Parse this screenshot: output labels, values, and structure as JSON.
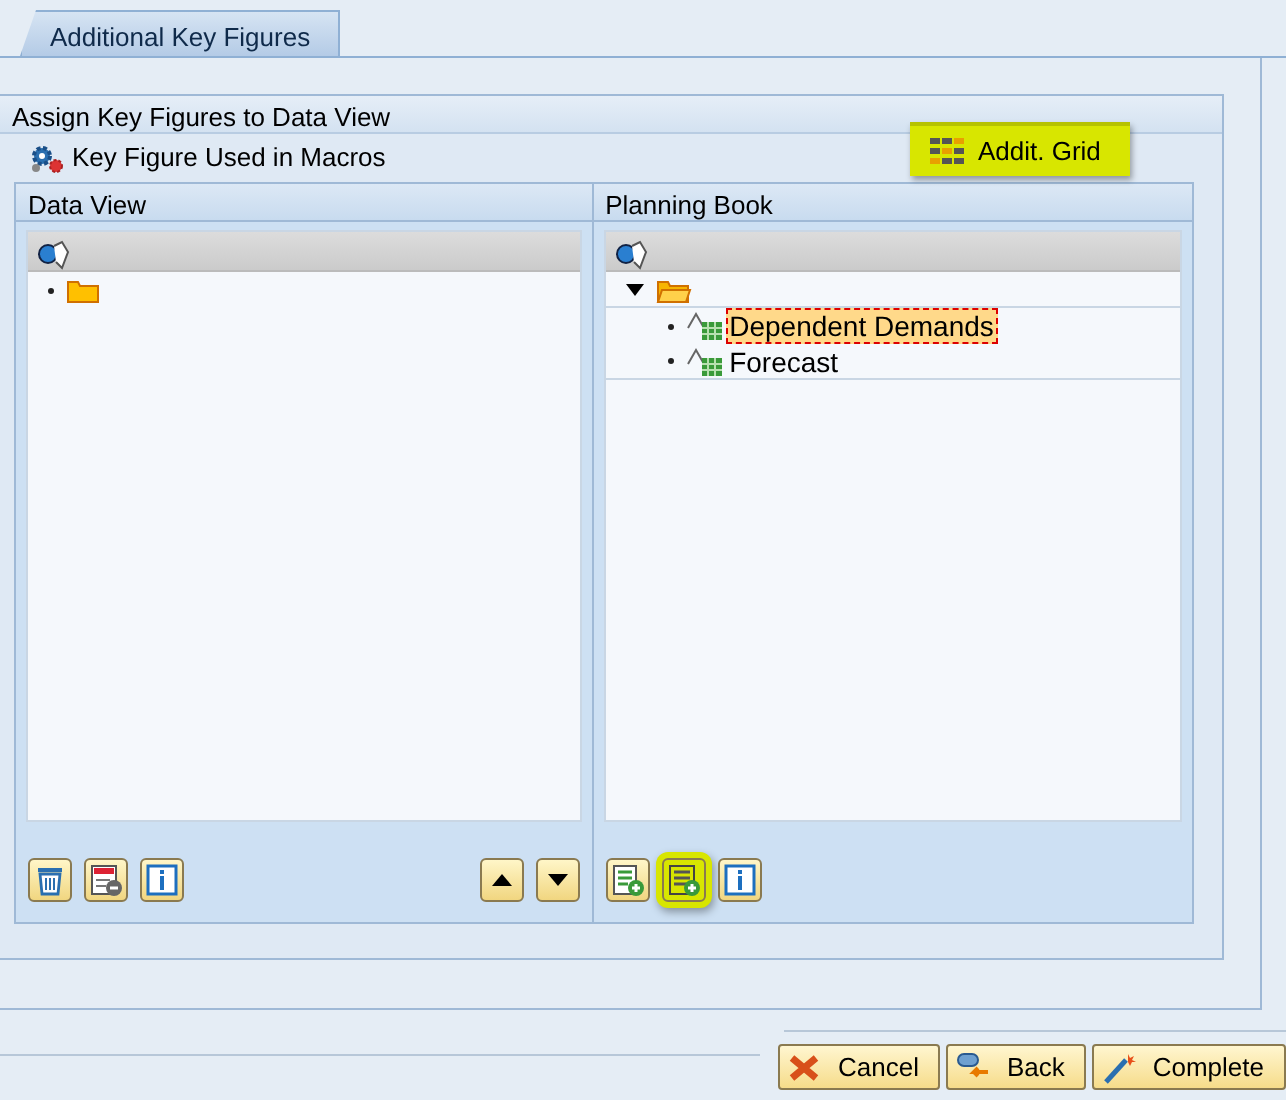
{
  "tabs": [
    {
      "label": "Additional Key Figures",
      "selected": true
    }
  ],
  "section": {
    "title": "Assign Key Figures to Data View",
    "macro_label": "Key Figure Used in Macros",
    "grid_button": {
      "label": "Addit. Grid",
      "highlighted": true
    }
  },
  "panels": [
    {
      "title": "Data View",
      "tree": [
        {
          "kind": "folder",
          "expanded": false
        }
      ],
      "tools_start": [
        {
          "kind": "delete",
          "highlighted": false
        },
        {
          "kind": "remove-row",
          "highlighted": false
        },
        {
          "kind": "info",
          "highlighted": false
        }
      ],
      "tools_end": [
        {
          "kind": "up",
          "highlighted": false
        },
        {
          "kind": "down",
          "highlighted": false
        }
      ]
    },
    {
      "title": "Planning Book",
      "tree": [
        {
          "kind": "folder",
          "expanded": true,
          "children": [
            {
              "kind": "key-figure",
              "label": "Dependent Demands",
              "selected": true
            },
            {
              "kind": "key-figure",
              "label": "Forecast",
              "selected": false
            }
          ]
        }
      ],
      "tools_start": [
        {
          "kind": "add-row",
          "highlighted": false
        },
        {
          "kind": "add-grid",
          "highlighted": true
        },
        {
          "kind": "info",
          "highlighted": false
        }
      ]
    }
  ],
  "footer_buttons": [
    {
      "kind": "cancel",
      "label": "Cancel"
    },
    {
      "kind": "back",
      "label": "Back"
    },
    {
      "kind": "complete",
      "label": "Complete"
    }
  ]
}
